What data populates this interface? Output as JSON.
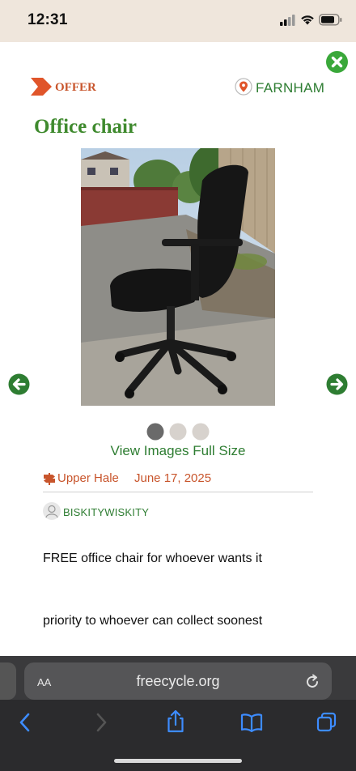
{
  "status_bar": {
    "time": "12:31"
  },
  "listing": {
    "type_label": "OFFER",
    "location": "FARNHAM",
    "title": "Office chair",
    "view_full_size": "View Images Full Size",
    "area": "Upper Hale",
    "date": "June 17, 2025",
    "username": "BISKITYWISKITY",
    "description_lines": [
      "FREE office chair for whoever wants it",
      "priority to whoever can collect soonest"
    ],
    "image_count": 3,
    "active_image_index": 0
  },
  "browser": {
    "aa_label": "AA",
    "url": "freecycle.org"
  },
  "colors": {
    "brand_green": "#2e7d32",
    "offer_orange": "#c8552c",
    "close_green": "#3aa83a"
  },
  "icons": [
    "offer-chevron-icon",
    "location-pin-icon",
    "close-icon",
    "arrow-left-icon",
    "arrow-right-icon",
    "signpost-icon",
    "user-icon",
    "reload-icon",
    "back-icon",
    "forward-icon",
    "share-icon",
    "bookmarks-icon",
    "tabs-icon"
  ]
}
